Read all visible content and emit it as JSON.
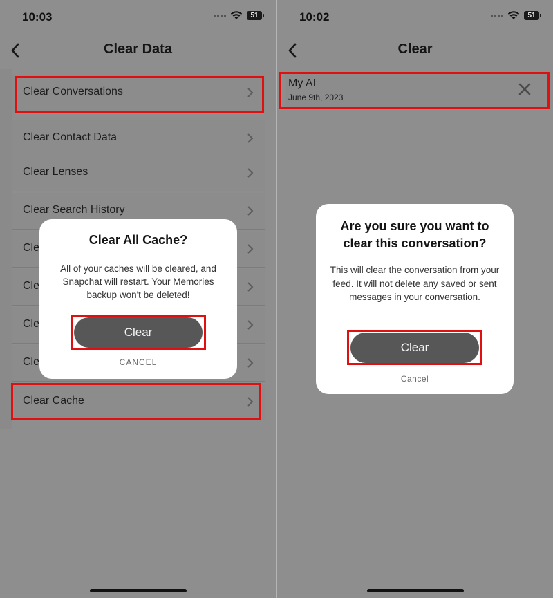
{
  "left": {
    "time": "10:03",
    "battery": "51",
    "title": "Clear Data",
    "rows": [
      "Clear Conversations",
      "Clear Contact Data",
      "Clear Lenses",
      "Clear Search History",
      "Cle",
      "Cle",
      "Cle",
      "Cle",
      "Clear Cache"
    ],
    "dialog": {
      "title": "Clear All Cache?",
      "body": "All of your caches will be cleared, and Snapchat will restart. Your Memories backup won't be deleted!",
      "confirm": "Clear",
      "cancel": "CANCEL"
    }
  },
  "right": {
    "time": "10:02",
    "battery": "51",
    "title": "Clear",
    "item": {
      "name": "My AI",
      "date": "June 9th, 2023"
    },
    "dialog": {
      "title": "Are you sure you want to clear this conversation?",
      "body": "This will clear the conversation from your feed. It will not delete any saved or sent messages in your conversation.",
      "confirm": "Clear",
      "cancel": "Cancel"
    }
  },
  "colors": {
    "highlight": "#e01010",
    "overlay_bg": "#8e8e8e",
    "button_bg": "#575757"
  },
  "icons": [
    "back-chevron-icon",
    "chevron-right-icon",
    "wifi-icon",
    "signal-icon",
    "battery-icon",
    "close-icon"
  ]
}
